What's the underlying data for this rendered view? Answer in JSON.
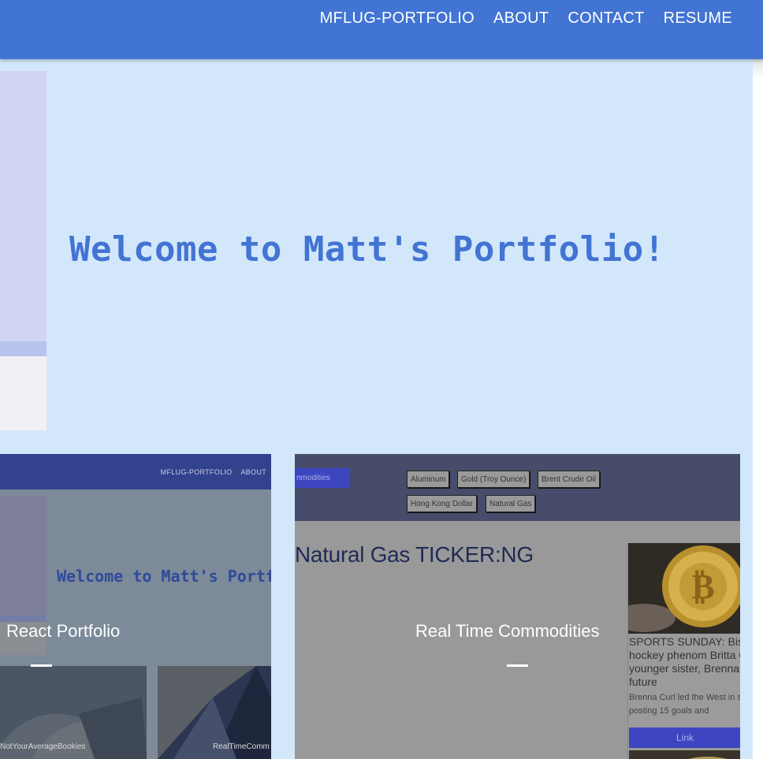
{
  "nav": {
    "links": [
      "MFLUG-PORTFOLIO",
      "ABOUT",
      "CONTACT",
      "RESUME"
    ]
  },
  "hero": {
    "title": "Welcome to Matt's Portfolio!"
  },
  "projects": [
    {
      "label": "React Portfolio",
      "preview": {
        "nav_links": [
          "MFLUG-PORTFOLIO",
          "ABOUT"
        ],
        "title": "Welcome to Matt's Portf",
        "tiles": [
          "NotYourAverageBookies",
          "RealTimeComm"
        ]
      }
    },
    {
      "label": "Real Time Commodities",
      "preview": {
        "tab": "nmodities",
        "chips": [
          "Aluminum",
          "Gold (Troy Ounce)",
          "Brent Crude Oil",
          "Hong Kong Dollar",
          "Natural Gas"
        ],
        "title": "Natural Gas TICKER:NG",
        "news_headline": "SPORTS SUNDAY: Bism hockey phenom Britta C younger sister, Brenna, hockey future",
        "news_snippet": "Brenna Curl led the West in s season, posting 15 goals and",
        "link_label": "Link"
      }
    }
  ],
  "colors": {
    "navbar": "#4274d3",
    "page_background": "#d3e7fb",
    "hero_title": "#4274d3"
  }
}
